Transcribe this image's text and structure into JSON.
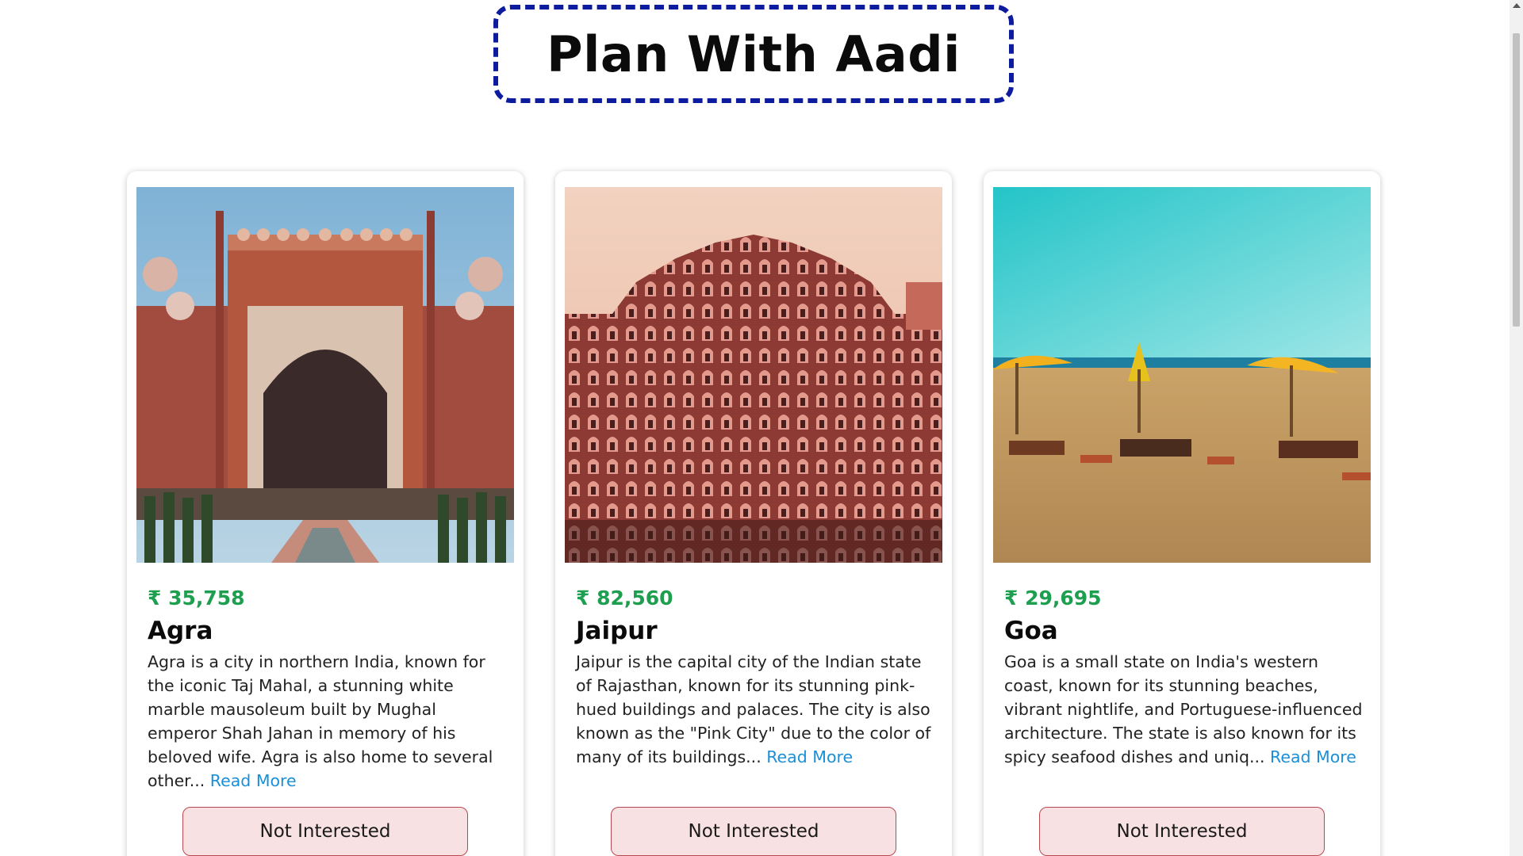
{
  "header": {
    "title": "Plan With Aadi"
  },
  "cards": [
    {
      "image_alt": "Taj Mahal gateway",
      "price": "₹ 35,758",
      "city": "Agra",
      "description": "Agra is a city in northern India, known for the iconic Taj Mahal, a stunning white marble mausoleum built by Mughal emperor Shah Jahan in memory of his beloved wife. Agra is also home to several other... ",
      "read_more": "Read More",
      "button": "Not Interested"
    },
    {
      "image_alt": "Hawa Mahal",
      "price": "₹ 82,560",
      "city": "Jaipur",
      "description": "Jaipur is the capital city of the Indian state of Rajasthan, known for its stunning pink-hued buildings and palaces. The city is also known as the \"Pink City\" due to the color of many of its buildings... ",
      "read_more": "Read More",
      "button": "Not Interested"
    },
    {
      "image_alt": "Goa beach with umbrellas",
      "price": "₹ 29,695",
      "city": "Goa",
      "description": "Goa is a small state on India's western coast, known for its stunning beaches, vibrant nightlife, and Portuguese-influenced architecture. The state is also known for its spicy seafood dishes and uniq... ",
      "read_more": "Read More",
      "button": "Not Interested"
    }
  ],
  "colors": {
    "title_border": "#0d1b9e",
    "price": "#1e9e4f",
    "link": "#1a8fd8",
    "button_bg": "#f8e1e3",
    "button_border": "#b8484f"
  }
}
